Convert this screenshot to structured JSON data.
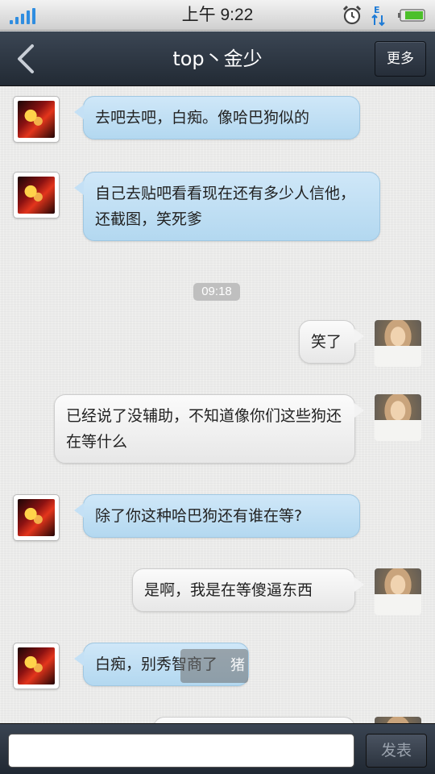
{
  "status_bar": {
    "time": "上午 9:22",
    "icons": [
      "signal-icon",
      "alarm-icon",
      "data-transfer-icon",
      "battery-icon"
    ]
  },
  "header": {
    "title": "top丶金少",
    "back_icon": "chevron-left-icon",
    "more_label": "更多"
  },
  "messages": [
    {
      "sender": "friend",
      "text": "去吧去吧，白痴。像哈巴狗似的"
    },
    {
      "sender": "friend",
      "text": "自己去贴吧看看现在还有多少人信他，还截图，笑死爹"
    },
    {
      "type": "timestamp",
      "text": "09:18"
    },
    {
      "sender": "me",
      "text": "笑了"
    },
    {
      "sender": "me",
      "text": "已经说了没辅助，不知道像你们这些狗还在等什么"
    },
    {
      "sender": "friend",
      "text": "除了你这种哈巴狗还有谁在等?"
    },
    {
      "sender": "me",
      "text": "是啊，我是在等傻逼东西"
    },
    {
      "sender": "friend",
      "text": "白痴，别秀智商了"
    }
  ],
  "overlay_text": "猪",
  "input": {
    "value": "",
    "placeholder": "",
    "send_label": "发表"
  },
  "colors": {
    "incoming_bubble": "#c4e0f5",
    "outgoing_bubble": "#f3f3f3",
    "bar_dark": "#2a323d",
    "signal": "#2f8de0",
    "battery": "#4cbf2a"
  }
}
